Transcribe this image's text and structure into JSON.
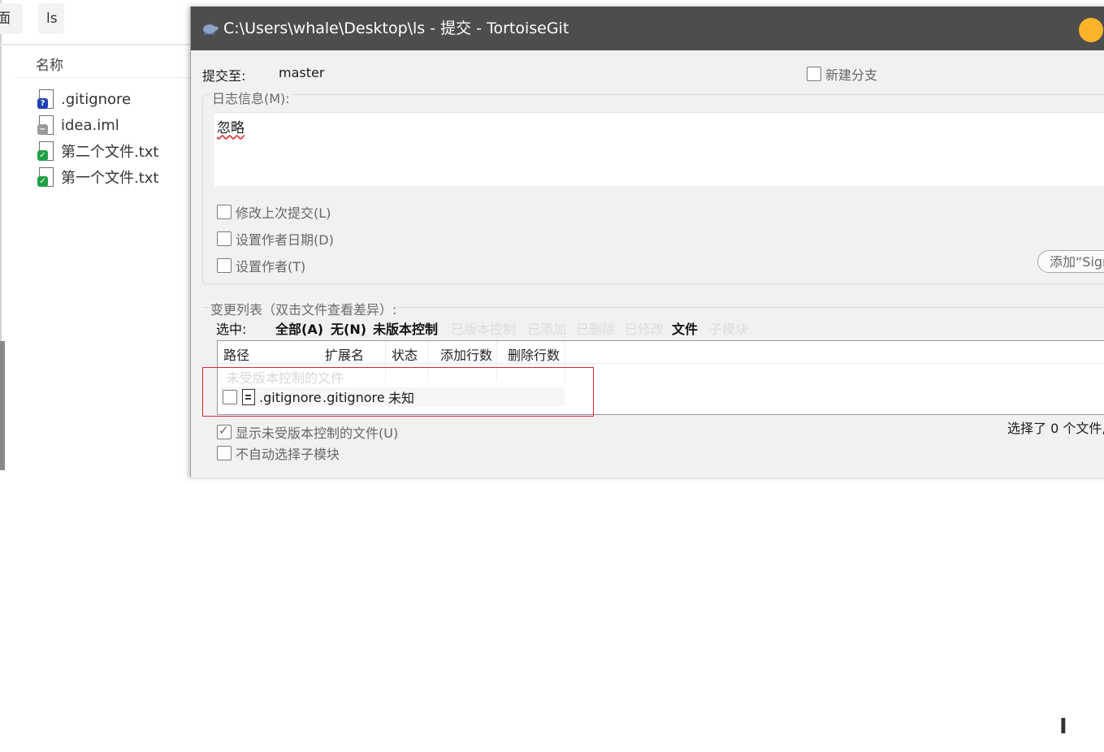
{
  "explorer": {
    "tab_left": "面",
    "tab_ls": "ls",
    "column_name": "名称",
    "files": [
      {
        "name": ".gitignore",
        "status_icon": "question-badge-icon"
      },
      {
        "name": "idea.iml",
        "status_icon": "ignored-badge-icon"
      },
      {
        "name": "第二个文件.txt",
        "status_icon": "check-badge-icon"
      },
      {
        "name": "第一个文件.txt",
        "status_icon": "check-badge-icon"
      }
    ]
  },
  "dialog": {
    "title": "C:\\Users\\whale\\Desktop\\ls - 提交 - TortoiseGit",
    "commit_to_label": "提交至:",
    "branch": "master",
    "new_branch_label": "新建分支",
    "log_message_label": "日志信息(M):",
    "log_message_value": "忽略",
    "amend_label": "修改上次提交(L)",
    "set_author_date_label": "设置作者日期(D)",
    "set_author_label": "设置作者(T)",
    "sign_button_label": "添加“Signed-off-by”",
    "changes_label": "变更列表（双击文件查看差异）:",
    "select_label": "选中:",
    "filters": {
      "all": "全部(A)",
      "none": "无(N)",
      "unversioned": "未版本控制",
      "versioned": "已版本控制",
      "added": "已添加",
      "deleted": "已删除",
      "modified": "已修改",
      "files": "文件",
      "submodules": "子模块"
    },
    "columns": [
      "路径",
      "扩展名",
      "状态",
      "添加行数",
      "删除行数"
    ],
    "group_unversioned": "未受版本控制的文件",
    "rows": [
      {
        "path": ".gitignore",
        "ext": ".gitignore",
        "status": "未知",
        "added": "",
        "deleted": ""
      }
    ],
    "show_unversioned_label": "显示未受版本控制的文件(U)",
    "no_auto_submodule_label": "不自动选择子模块",
    "selected_status": "选择了 0 个文件,"
  },
  "colors": {
    "titlebar": "#4d4d4d",
    "minimize_button": "#fbb42a",
    "highlight_box": "#d9252b"
  }
}
